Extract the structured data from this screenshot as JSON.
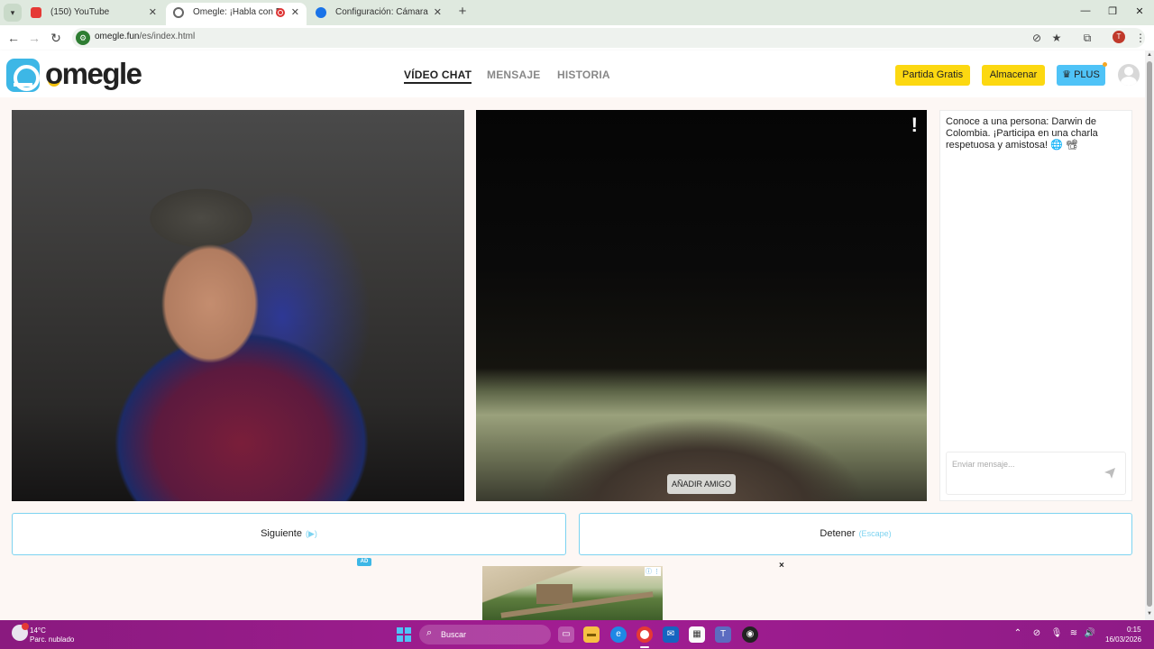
{
  "browser": {
    "tabs": [
      {
        "title": "(150) YouTube",
        "active": false,
        "favicon_color": "#e53935"
      },
      {
        "title": "Omegle: ¡Habla con Desconocidos!",
        "active": true,
        "favicon_color": "#666666"
      },
      {
        "title": "Configuración: Cámara",
        "active": false,
        "favicon_color": "#1a73e8"
      }
    ],
    "url_host": "omegle.fun",
    "url_path": "/es/index.html",
    "profile_initial": "T"
  },
  "site": {
    "logo_text": "omegle",
    "nav": [
      {
        "label": "VÍDEO CHAT",
        "active": true
      },
      {
        "label": "MENSAJE",
        "active": false
      },
      {
        "label": "HISTORIA",
        "active": false
      }
    ],
    "buttons": {
      "free_game": "Partida Gratis",
      "store": "Almacenar",
      "plus": "PLUS"
    },
    "accent_color": "#3db7e6",
    "button_yellow": "#fcd811"
  },
  "video": {
    "report_label": "!",
    "add_friend_label": "AÑADIR AMIGO"
  },
  "chat": {
    "intro_message": "Conoce a una persona: Darwin de Colombia. ¡Participa en una charla respetuosa y amistosa! 🌐 📽",
    "input_placeholder": "Enviar mensaje..."
  },
  "controls": {
    "next_label": "Siguiente",
    "next_hint": "(▶)",
    "stop_label": "Detener",
    "stop_hint": "(Escape)"
  },
  "ad": {
    "tag": "AD",
    "close": "×"
  },
  "taskbar": {
    "weather_temp": "14°C",
    "weather_desc": "Parc. nublado",
    "search_label": "Buscar",
    "time": "0:15",
    "date": "16/03/2026"
  }
}
